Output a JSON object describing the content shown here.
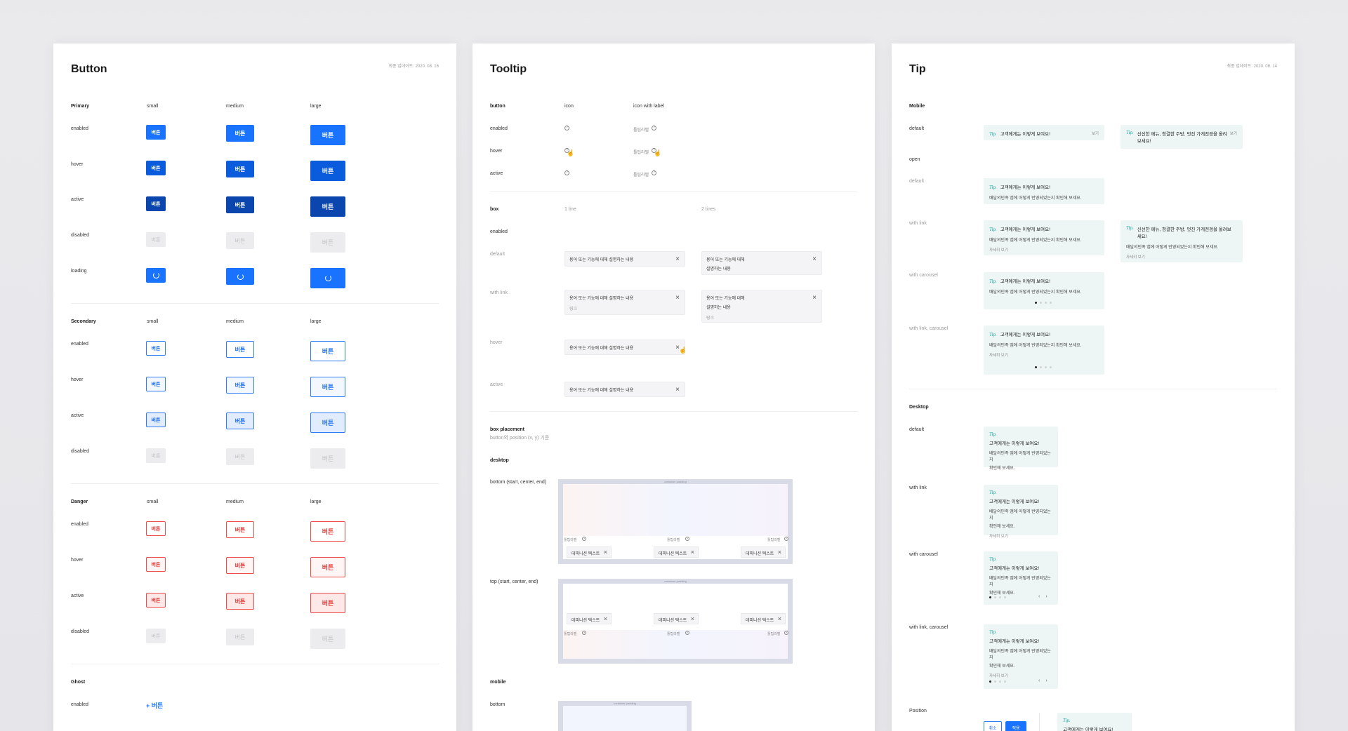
{
  "button_panel": {
    "title": "Button",
    "date": "최종 업데이트: 2020. 08. 16",
    "primary": {
      "label": "Primary",
      "sizes": [
        "small",
        "medium",
        "large"
      ],
      "states": [
        "enabled",
        "hover",
        "active",
        "disabled",
        "loading"
      ]
    },
    "secondary": {
      "label": "Secondary",
      "sizes": [
        "small",
        "medium",
        "large"
      ],
      "states": [
        "enabled",
        "hover",
        "active",
        "disabled"
      ]
    },
    "danger": {
      "label": "Danger",
      "sizes": [
        "small",
        "medium",
        "large"
      ],
      "states": [
        "enabled",
        "hover",
        "active",
        "disabled"
      ]
    },
    "ghost": {
      "label": "Ghost",
      "state": "enabled",
      "button": "+ 버튼"
    },
    "btn_text": "버튼"
  },
  "tooltip_panel": {
    "title": "Tooltip",
    "button_section": {
      "label": "button",
      "cols": [
        "icon",
        "icon with label"
      ],
      "states": [
        "enabled",
        "hover",
        "active"
      ],
      "icon_label": "툴팁라벨"
    },
    "box_section": {
      "label": "box",
      "cols": [
        "1 line",
        "2 lines"
      ],
      "state_enabled": "enabled",
      "rows": [
        "default",
        "with link",
        "hover",
        "active"
      ],
      "text_1line": "용어 또는 기능에 대해 설명하는 내용",
      "text_2line_a": "용어 또는 기능에 대해",
      "text_2line_b": "설명하는 내용",
      "link": "링크",
      "close": "×"
    },
    "placement": {
      "label": "box placement",
      "sub": "button의 position (x, y) 기준",
      "desktop": "desktop",
      "bottom_label": "bottom (start, center, end)",
      "top_label": "top (start, center, end)",
      "mobile": "mobile",
      "mobile_bottom": "bottom",
      "container": "container padding",
      "chip_text": "데피니션 텍스트",
      "icon_label": "툴팁라벨"
    }
  },
  "tip_panel": {
    "title": "Tip",
    "date": "최종 업데이트: 2020. 08. 14",
    "mobile": "Mobile",
    "rows": {
      "default": "default",
      "open": "open",
      "open_default": "default",
      "with_link": "with link",
      "with_carousel": "with carousel",
      "with_link_carousel": "with link, carousel"
    },
    "desktop": "Desktop",
    "desktop_rows": [
      "default",
      "with link",
      "with carousel",
      "with link, carousel"
    ],
    "position": "Position",
    "brand": "Tip.",
    "headline": "고객에게는 이렇게 보여요!",
    "headline_long": "신선한 메뉴, 청결한 주방, 멋진 가게전경을 올려보세요!",
    "headline_long_a": "신선한 메뉴, 청결한 주방, 멋진 가게전경을 올",
    "headline_long_b": "려보세요!",
    "desc": "배달의민족 앱에 어떻게 반영되었는지 확인해 보세요.",
    "desc_a": "배달의민족 앱에 어떻게 반영되었는지",
    "desc_b": "확인해 보세요.",
    "more": "보기",
    "link": "자세히 보기",
    "cancel": "취소",
    "confirm": "적용"
  }
}
